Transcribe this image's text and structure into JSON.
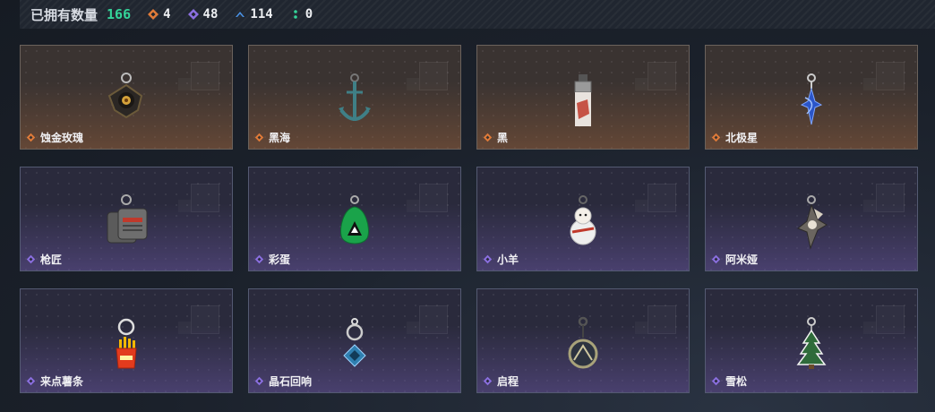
{
  "summary": {
    "owned_label": "已拥有数量",
    "owned_count": "166",
    "stats": [
      {
        "icon": "orange-diamond-icon",
        "value": "4",
        "color": "#e07b39"
      },
      {
        "icon": "purple-diamond-icon",
        "value": "48",
        "color": "#8b6fe0"
      },
      {
        "icon": "blue-chevron-icon",
        "value": "114",
        "color": "#4a90e2"
      },
      {
        "icon": "green-dots-icon",
        "value": "0",
        "color": "#34d399"
      }
    ]
  },
  "items": [
    {
      "name": "蚀金玫瑰",
      "rarity": "orange",
      "charm": "rose-charm-icon"
    },
    {
      "name": "黑海",
      "rarity": "orange",
      "charm": "anchor-charm-icon"
    },
    {
      "name": "黑",
      "rarity": "orange",
      "charm": "lighter-charm-icon"
    },
    {
      "name": "北极星",
      "rarity": "orange",
      "charm": "star-charm-icon"
    },
    {
      "name": "枪匠",
      "rarity": "purple",
      "charm": "dogtag-charm-icon"
    },
    {
      "name": "彩蛋",
      "rarity": "purple",
      "charm": "egg-charm-icon"
    },
    {
      "name": "小羊",
      "rarity": "purple",
      "charm": "lamb-charm-icon"
    },
    {
      "name": "阿米娅",
      "rarity": "purple",
      "charm": "bunny-charm-icon"
    },
    {
      "name": "来点薯条",
      "rarity": "purple",
      "charm": "fries-charm-icon"
    },
    {
      "name": "晶石回响",
      "rarity": "purple",
      "charm": "crystal-charm-icon"
    },
    {
      "name": "启程",
      "rarity": "purple",
      "charm": "medal-charm-icon"
    },
    {
      "name": "雪松",
      "rarity": "purple",
      "charm": "tree-charm-icon"
    }
  ]
}
